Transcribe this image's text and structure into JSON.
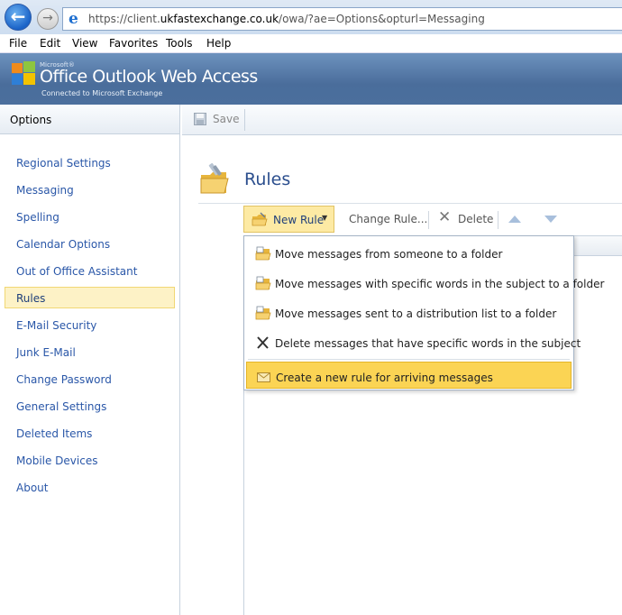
{
  "browser": {
    "url_prefix": "https://client.",
    "url_domain": "ukfastexchange.co.uk",
    "url_path": "/owa/?ae=Options&opturl=Messaging",
    "menu": [
      "File",
      "Edit",
      "View",
      "Favorites",
      "Tools",
      "Help"
    ]
  },
  "owa": {
    "logo_microsoft": "Microsoft®",
    "logo_title": "Office Outlook Web Access",
    "logo_subtitle": "Connected to Microsoft Exchange"
  },
  "left_pane": {
    "title": "Options",
    "items": [
      {
        "label": "Regional Settings",
        "selected": false
      },
      {
        "label": "Messaging",
        "selected": false
      },
      {
        "label": "Spelling",
        "selected": false
      },
      {
        "label": "Calendar Options",
        "selected": false
      },
      {
        "label": "Out of Office Assistant",
        "selected": false
      },
      {
        "label": "Rules",
        "selected": true
      },
      {
        "label": "E-Mail Security",
        "selected": false
      },
      {
        "label": "Junk E-Mail",
        "selected": false
      },
      {
        "label": "Change Password",
        "selected": false
      },
      {
        "label": "General Settings",
        "selected": false
      },
      {
        "label": "Deleted Items",
        "selected": false
      },
      {
        "label": "Mobile Devices",
        "selected": false
      },
      {
        "label": "About",
        "selected": false
      }
    ]
  },
  "toolbar": {
    "save_label": "Save"
  },
  "rules": {
    "title": "Rules",
    "new_rule_label": "New Rule",
    "change_rule_label": "Change Rule...",
    "delete_label": "Delete",
    "menu_items": [
      {
        "label": "Move messages from someone to a folder",
        "icon": "move-to-folder-icon",
        "selected": false
      },
      {
        "label": "Move messages with specific words in the subject to a folder",
        "icon": "move-to-folder-icon",
        "selected": false
      },
      {
        "label": "Move messages sent to a distribution list to a folder",
        "icon": "move-to-folder-icon",
        "selected": false
      },
      {
        "label": "Delete messages that have specific words in the subject",
        "icon": "delete-icon",
        "selected": false
      },
      {
        "label": "Create a new rule for arriving messages",
        "icon": "envelope-icon",
        "selected": true
      }
    ]
  },
  "colors": {
    "accent": "#2c4f8e",
    "link": "#2a57a8",
    "selection": "#fbd454",
    "nav_selection": "#fdf2c6",
    "header": "#4a6d9b"
  }
}
